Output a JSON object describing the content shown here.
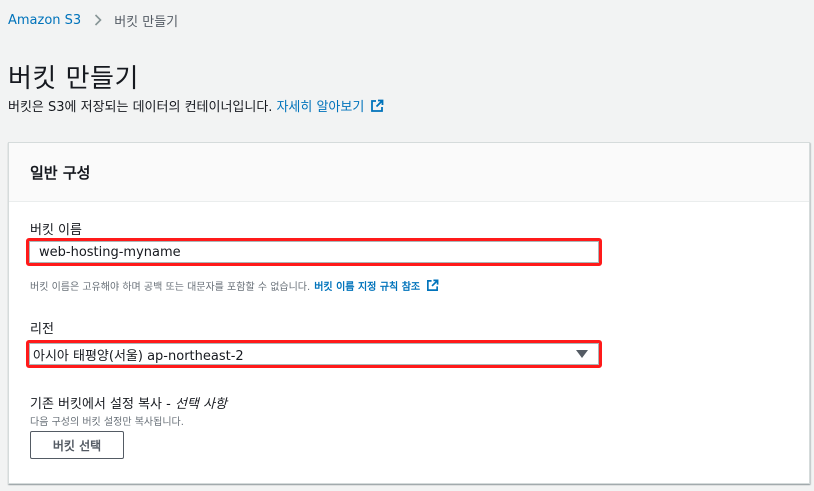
{
  "breadcrumb": {
    "root": "Amazon S3",
    "current": "버킷 만들기"
  },
  "page": {
    "title": "버킷 만들기",
    "description": "버킷은 S3에 저장되는 데이터의 컨테이너입니다.",
    "learn_more": "자세히 알아보기"
  },
  "general": {
    "header": "일반 구성",
    "bucket_name_label": "버킷 이름",
    "bucket_name_value": "web-hosting-myname",
    "bucket_name_hint": "버킷 이름은 고유해야 하며 공백 또는 대문자를 포함할 수 없습니다.",
    "bucket_name_rules_link": "버킷 이름 지정 규칙 참조",
    "region_label": "리전",
    "region_value": "아시아 태평양(서울) ap-northeast-2",
    "copy_label": "기존 버킷에서 설정 복사 - ",
    "copy_optional": "선택 사항",
    "copy_hint": "다음 구성의 버킷 설정만 복사됩니다.",
    "choose_bucket_button": "버킷 선택"
  },
  "colors": {
    "link": "#0073bb",
    "highlight": "#ff1a1a",
    "background": "#f2f3f3"
  }
}
